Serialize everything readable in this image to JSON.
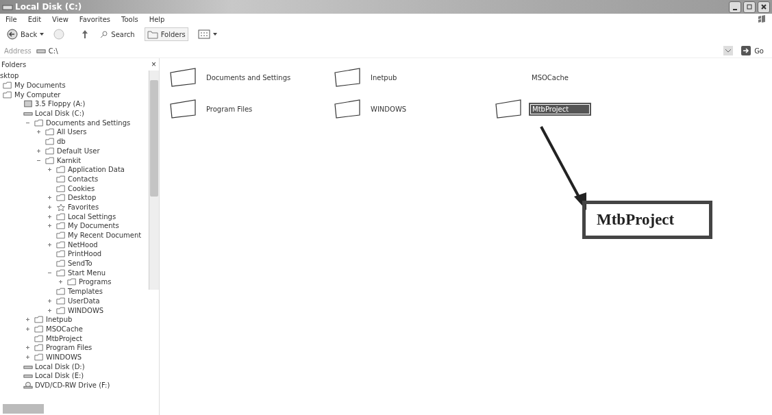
{
  "window": {
    "title": "Local Disk (C:)"
  },
  "menu": [
    "File",
    "Edit",
    "View",
    "Favorites",
    "Tools",
    "Help"
  ],
  "toolbar": {
    "back": "Back",
    "search": "Search",
    "folders": "Folders"
  },
  "address": {
    "label": "Address",
    "value": "C:\\",
    "go": "Go"
  },
  "folders_pane": {
    "title": "Folders",
    "close": "×",
    "tree": [
      {
        "label": "sktop",
        "children": [
          {
            "label": "My Documents",
            "kind": "folder"
          },
          {
            "label": "My Computer",
            "kind": "folder",
            "children": [
              {
                "label": "3.5 Floppy (A:)",
                "kind": "floppy"
              },
              {
                "label": "Local Disk (C:)",
                "kind": "drive",
                "children": [
                  {
                    "label": "Documents and Settings",
                    "kind": "folder",
                    "expanded": true,
                    "children": [
                      {
                        "label": "All Users",
                        "kind": "folder",
                        "expanded": false
                      },
                      {
                        "label": "db",
                        "kind": "folder"
                      },
                      {
                        "label": "Default User",
                        "kind": "folder",
                        "expanded": false
                      },
                      {
                        "label": "Karnkit",
                        "kind": "folder",
                        "expanded": true,
                        "children": [
                          {
                            "label": "Application Data",
                            "kind": "folder",
                            "expanded": false
                          },
                          {
                            "label": "Contacts",
                            "kind": "folder"
                          },
                          {
                            "label": "Cookies",
                            "kind": "folder"
                          },
                          {
                            "label": "Desktop",
                            "kind": "folder",
                            "expanded": false
                          },
                          {
                            "label": "Favorites",
                            "kind": "star",
                            "expanded": false
                          },
                          {
                            "label": "Local Settings",
                            "kind": "folder",
                            "expanded": false
                          },
                          {
                            "label": "My Documents",
                            "kind": "folder",
                            "expanded": false
                          },
                          {
                            "label": "My Recent Document",
                            "kind": "folder"
                          },
                          {
                            "label": "NetHood",
                            "kind": "folder",
                            "expanded": false
                          },
                          {
                            "label": "PrintHood",
                            "kind": "folder"
                          },
                          {
                            "label": "SendTo",
                            "kind": "folder"
                          },
                          {
                            "label": "Start Menu",
                            "kind": "folder",
                            "expanded": true,
                            "children": [
                              {
                                "label": "Programs",
                                "kind": "folder",
                                "expanded": false
                              }
                            ]
                          },
                          {
                            "label": "Templates",
                            "kind": "folder"
                          },
                          {
                            "label": "UserData",
                            "kind": "folder",
                            "expanded": false
                          },
                          {
                            "label": "WINDOWS",
                            "kind": "folder",
                            "expanded": false
                          }
                        ]
                      }
                    ]
                  },
                  {
                    "label": "Inetpub",
                    "kind": "folder",
                    "expanded": false
                  },
                  {
                    "label": "MSOCache",
                    "kind": "folder",
                    "expanded": false
                  },
                  {
                    "label": "MtbProject",
                    "kind": "folder"
                  },
                  {
                    "label": "Program Files",
                    "kind": "folder",
                    "expanded": false
                  },
                  {
                    "label": "WINDOWS",
                    "kind": "folder",
                    "expanded": false
                  }
                ]
              },
              {
                "label": "Local Disk (D:)",
                "kind": "drive"
              },
              {
                "label": "Local Disk (E:)",
                "kind": "drive"
              },
              {
                "label": "DVD/CD-RW Drive (F:)",
                "kind": "cd"
              }
            ]
          }
        ]
      }
    ]
  },
  "files": [
    {
      "name": "Documents and Settings",
      "selected": false,
      "icon": true
    },
    {
      "name": "Inetpub",
      "selected": false,
      "icon": true
    },
    {
      "name": "MSOCache",
      "selected": false,
      "icon": false
    },
    {
      "name": "Program Files",
      "selected": false,
      "icon": true
    },
    {
      "name": "WINDOWS",
      "selected": false,
      "icon": true
    },
    {
      "name": "MtbProject",
      "selected": true,
      "icon": true
    }
  ],
  "callout": {
    "text": "MtbProject"
  }
}
